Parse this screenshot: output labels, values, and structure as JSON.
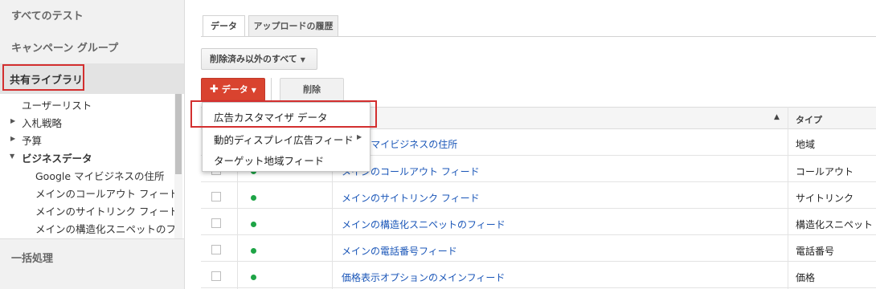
{
  "sidebar": {
    "all_tests": "すべてのテスト",
    "campaign_groups": "キャンペーン グループ",
    "shared_library": "共有ライブラリ",
    "items": [
      {
        "label": "ユーザーリスト"
      },
      {
        "label": "入札戦略"
      },
      {
        "label": "予算"
      },
      {
        "label": "ビジネスデータ"
      },
      {
        "label": "Google マイビジネスの住所"
      },
      {
        "label": "メインのコールアウト フィード"
      },
      {
        "label": "メインのサイトリンク フィード"
      },
      {
        "label": "メインの構造化スニペットのフ"
      }
    ],
    "bulk": "一括処理"
  },
  "tabs": [
    {
      "label": "データ"
    },
    {
      "label": "アップロードの履歴"
    }
  ],
  "toolbar": {
    "filter_label": "削除済み以外のすべて",
    "data_button": "データ",
    "delete_button": "削除"
  },
  "menu": {
    "items": [
      {
        "label": "広告カスタマイザ データ"
      },
      {
        "label": "動的ディスプレイ広告フィード"
      },
      {
        "label": "ターゲット地域フィード"
      }
    ]
  },
  "table": {
    "header_type": "タイプ",
    "rows": [
      {
        "name": "e マイビジネスの住所",
        "type": "地域"
      },
      {
        "name": "メインのコールアウト フィード",
        "type": "コールアウト"
      },
      {
        "name": "メインのサイトリンク フィード",
        "type": "サイトリンク"
      },
      {
        "name": "メインの構造化スニペットのフィード",
        "type": "構造化スニペット"
      },
      {
        "name": "メインの電話番号フィード",
        "type": "電話番号"
      },
      {
        "name": "価格表示オプションのメインフィード",
        "type": "価格"
      }
    ]
  },
  "colors": {
    "accent_red": "#d9432f",
    "link_blue": "#1a56b8",
    "status_green": "#1ea446",
    "highlight_border": "#d32f2f"
  },
  "icons": [
    "plus-icon",
    "caret-down-icon",
    "sort-up-icon",
    "tree-arrow-icon",
    "submenu-arrow-icon",
    "status-dot-icon"
  ]
}
